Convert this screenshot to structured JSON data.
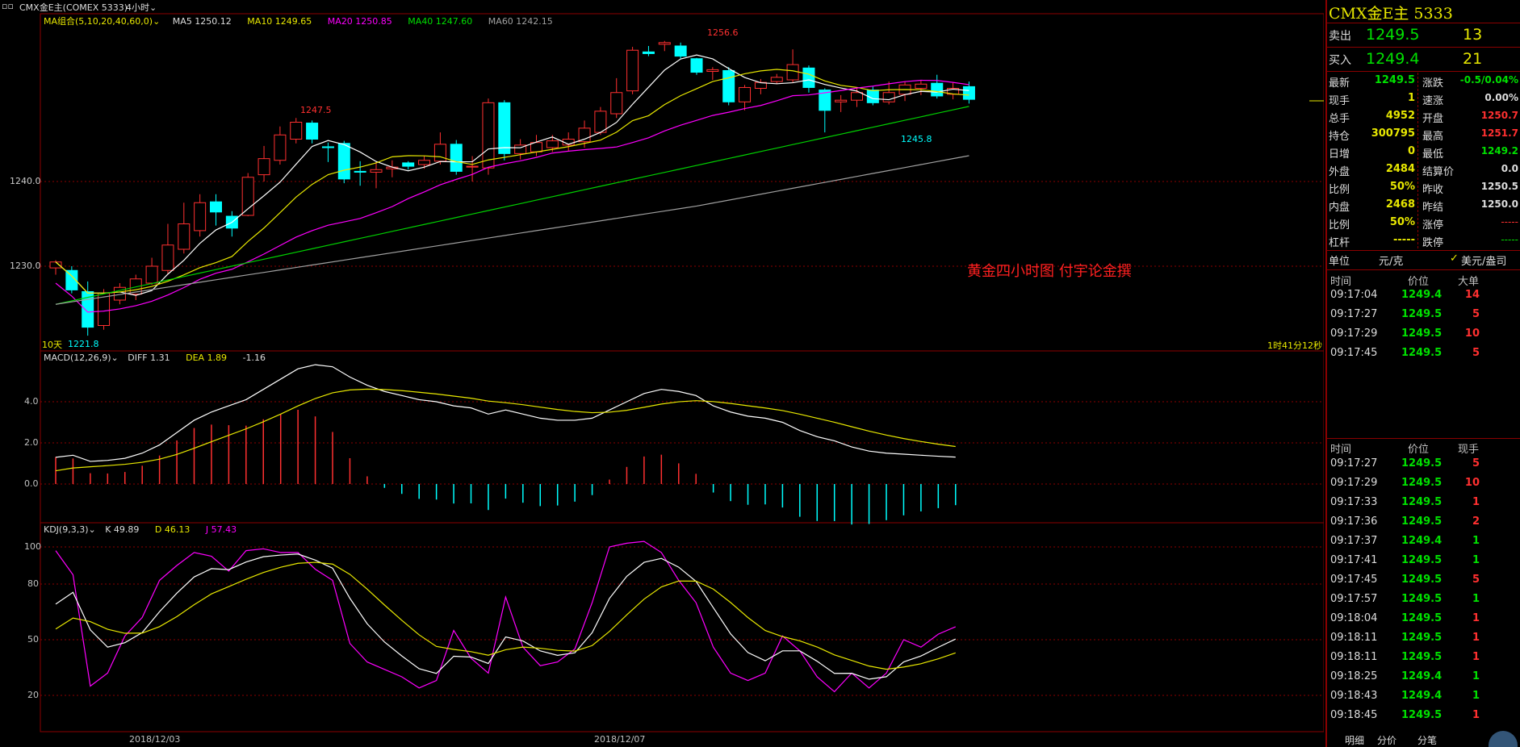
{
  "topbar": {
    "window_icon": "window-controls-icon",
    "instrument": "CMX金E主(COMEX 5333)",
    "period": "4小时",
    "dropdown_icon": "chevron-down-icon"
  },
  "main_panel": {
    "ma_legend": {
      "group": "MA组合(5,10,20,40,60,0)",
      "ma5": "MA5 1250.12",
      "ma10": "MA10 1249.65",
      "ma20": "MA20 1250.85",
      "ma40": "MA40 1247.60",
      "ma60": "MA60 1242.15"
    },
    "y_ticks": [
      "1240.0",
      "1230.0"
    ],
    "annotations": {
      "high1": "1247.5",
      "high2": "1256.6",
      "low1": "1221.8",
      "low2": "1245.8",
      "period_tag": "10天",
      "countdown": "1时41分12秒",
      "watermark": "黄金四小时图  付宇论金撰"
    }
  },
  "macd_panel": {
    "legend": {
      "name": "MACD(12,26,9)",
      "diff": "DIFF 1.31",
      "dea": "DEA 1.89",
      "macd": "-1.16"
    },
    "y_ticks": [
      "4.0",
      "2.0",
      "0.0"
    ]
  },
  "kdj_panel": {
    "legend": {
      "name": "KDJ(9,3,3)",
      "k": "K 49.89",
      "d": "D 46.13",
      "j": "J 57.43"
    },
    "y_ticks": [
      "100",
      "80",
      "50",
      "20"
    ]
  },
  "x_axis": {
    "dates": [
      "2018/12/03",
      "2018/12/07"
    ]
  },
  "colors": {
    "up_candle": "#ff3030",
    "down_candle": "#00ffff",
    "ma5": "#ffffff",
    "ma10": "#e8e800",
    "ma20": "#ff00ff",
    "ma40": "#00d000",
    "ma60": "#a0a0a0",
    "grid": "#8b0000"
  },
  "quote_panel": {
    "title": "CMX金E主  5333",
    "sell": {
      "label": "卖出",
      "price": "1249.5",
      "vol": "13"
    },
    "buy": {
      "label": "买入",
      "price": "1249.4",
      "vol": "21"
    },
    "stats": [
      {
        "l1": "最新",
        "v1": "1249.5",
        "l2": "涨跌",
        "v2": "-0.5/0.04%"
      },
      {
        "l1": "现手",
        "v1": "1",
        "l2": "速涨",
        "v2": "0.00%"
      },
      {
        "l1": "总手",
        "v1": "4952",
        "l2": "开盘",
        "v2": "1250.7"
      },
      {
        "l1": "持仓",
        "v1": "300795",
        "l2": "最高",
        "v2": "1251.7"
      },
      {
        "l1": "日增",
        "v1": "0",
        "l2": "最低",
        "v2": "1249.2"
      },
      {
        "l1": "外盘",
        "v1": "2484",
        "l2": "结算价",
        "v2": "0.0"
      },
      {
        "l1": "比例",
        "v1": "50%",
        "l2": "昨收",
        "v2": "1250.5"
      },
      {
        "l1": "内盘",
        "v1": "2468",
        "l2": "昨结",
        "v2": "1250.0"
      },
      {
        "l1": "比例",
        "v1": "50%",
        "l2": "涨停",
        "v2": "-----"
      },
      {
        "l1": "杠杆",
        "v1": "-----",
        "l2": "跌停",
        "v2": "-----"
      }
    ],
    "unit": {
      "label": "单位",
      "value": "元/克",
      "alt": "美元/盎司"
    },
    "big_orders": {
      "headers": [
        "时间",
        "价位",
        "大单"
      ],
      "rows": [
        [
          "09:17:04",
          "1249.4",
          "14"
        ],
        [
          "09:17:27",
          "1249.5",
          "5"
        ],
        [
          "09:17:29",
          "1249.5",
          "10"
        ],
        [
          "09:17:45",
          "1249.5",
          "5"
        ]
      ]
    },
    "ticks": {
      "headers": [
        "时间",
        "价位",
        "现手"
      ],
      "rows": [
        [
          "09:17:27",
          "1249.5",
          "5"
        ],
        [
          "09:17:29",
          "1249.5",
          "10"
        ],
        [
          "09:17:33",
          "1249.5",
          "1"
        ],
        [
          "09:17:36",
          "1249.5",
          "2"
        ],
        [
          "09:17:37",
          "1249.4",
          "1"
        ],
        [
          "09:17:41",
          "1249.5",
          "1"
        ],
        [
          "09:17:45",
          "1249.5",
          "5"
        ],
        [
          "09:17:57",
          "1249.5",
          "1"
        ],
        [
          "09:18:04",
          "1249.5",
          "1"
        ],
        [
          "09:18:11",
          "1249.5",
          "1"
        ],
        [
          "09:18:11",
          "1249.5",
          "1"
        ],
        [
          "09:18:25",
          "1249.4",
          "1"
        ],
        [
          "09:18:43",
          "1249.4",
          "1"
        ],
        [
          "09:18:45",
          "1249.5",
          "1"
        ]
      ]
    },
    "tabs": [
      "明细",
      "分价",
      "分笔"
    ]
  }
}
